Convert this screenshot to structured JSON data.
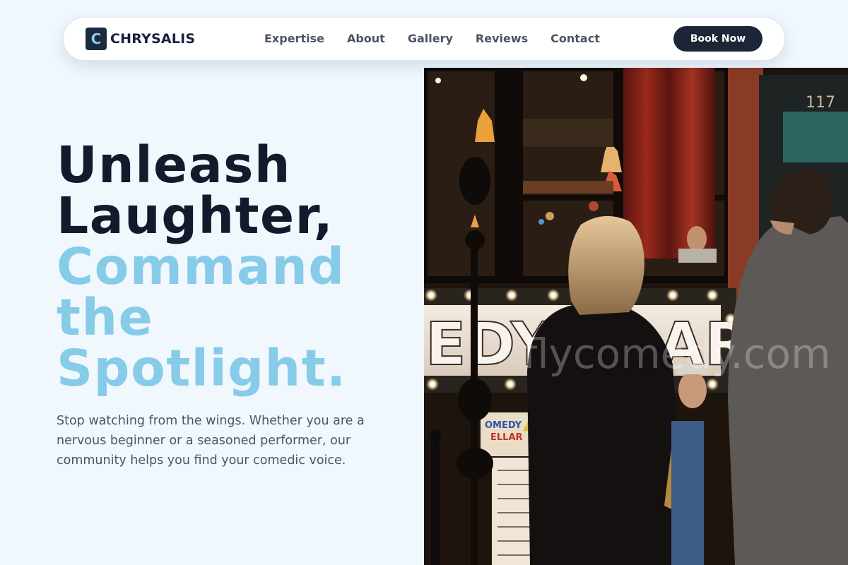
{
  "brand": {
    "logo_letter": "C",
    "name": "CHRYSALIS"
  },
  "nav": {
    "links": [
      "Expertise",
      "About",
      "Gallery",
      "Reviews",
      "Contact"
    ],
    "cta": "Book Now"
  },
  "hero": {
    "title_line1": "Unleash",
    "title_line2": "Laughter,",
    "title_accent_line1": "Command",
    "title_accent_line2": "the",
    "title_accent_line3": "Spotlight.",
    "subtitle": "Stop watching from the wings. Whether you are a nervous beginner or a seasoned performer, our community helps you find your comedic voice."
  },
  "photo": {
    "door_number": "117",
    "marquee_letters_left": "EDY",
    "marquee_letters_right": "AR",
    "sign_line1": "OMEDY",
    "sign_line2": "ELLAR",
    "watermark": "flycomedy.com"
  },
  "colors": {
    "background": "#f0f7fd",
    "heading_dark": "#121a2c",
    "heading_accent": "#86cbe8",
    "button_bg": "#1c2637",
    "body_text": "#4a5568"
  }
}
